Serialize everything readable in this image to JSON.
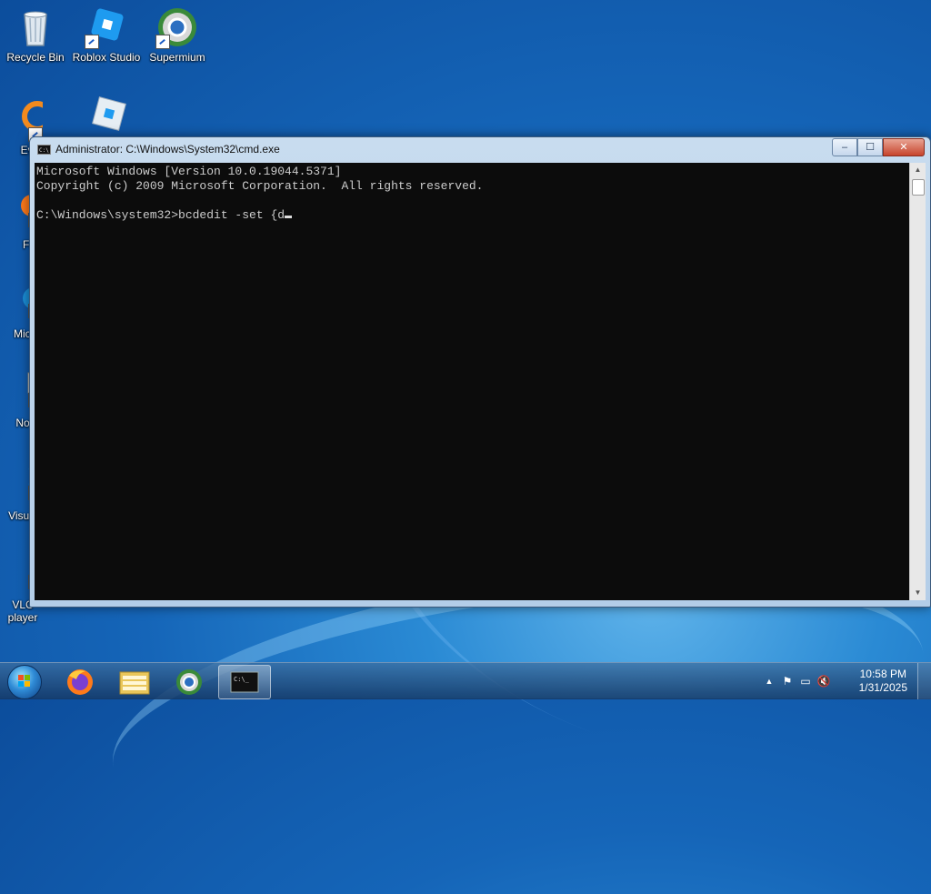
{
  "desktop": {
    "icons": [
      {
        "label": "Recycle Bin"
      },
      {
        "label": "Roblox Studio"
      },
      {
        "label": "Supermium"
      },
      {
        "label": "Eve"
      },
      {
        "label": "Fi"
      },
      {
        "label": "Mic E"
      },
      {
        "label": "Note"
      },
      {
        "label": "Visua C"
      },
      {
        "label": "VLC player"
      }
    ]
  },
  "window": {
    "title": "Administrator: C:\\Windows\\System32\\cmd.exe",
    "icon": "cmd-icon",
    "buttons": {
      "minimize": "‒",
      "maximize": "☐",
      "close": "✕"
    },
    "console_lines": [
      "Microsoft Windows [Version 10.0.19044.5371]",
      "Copyright (c) 2009 Microsoft Corporation.  All rights reserved.",
      "",
      "C:\\Windows\\system32>bcdedit -set {d"
    ]
  },
  "taskbar": {
    "start_icon": "windows-orb-icon",
    "pinned": [
      "firefox-icon",
      "file-explorer-icon",
      "supermium-icon",
      "cmd-icon"
    ],
    "active": "cmd-icon",
    "tray": {
      "icons": [
        "show-hidden-icons",
        "action-center-flag-icon",
        "network-icon",
        "volume-muted-icon"
      ],
      "time": "10:58 PM",
      "date": "1/31/2025"
    }
  }
}
